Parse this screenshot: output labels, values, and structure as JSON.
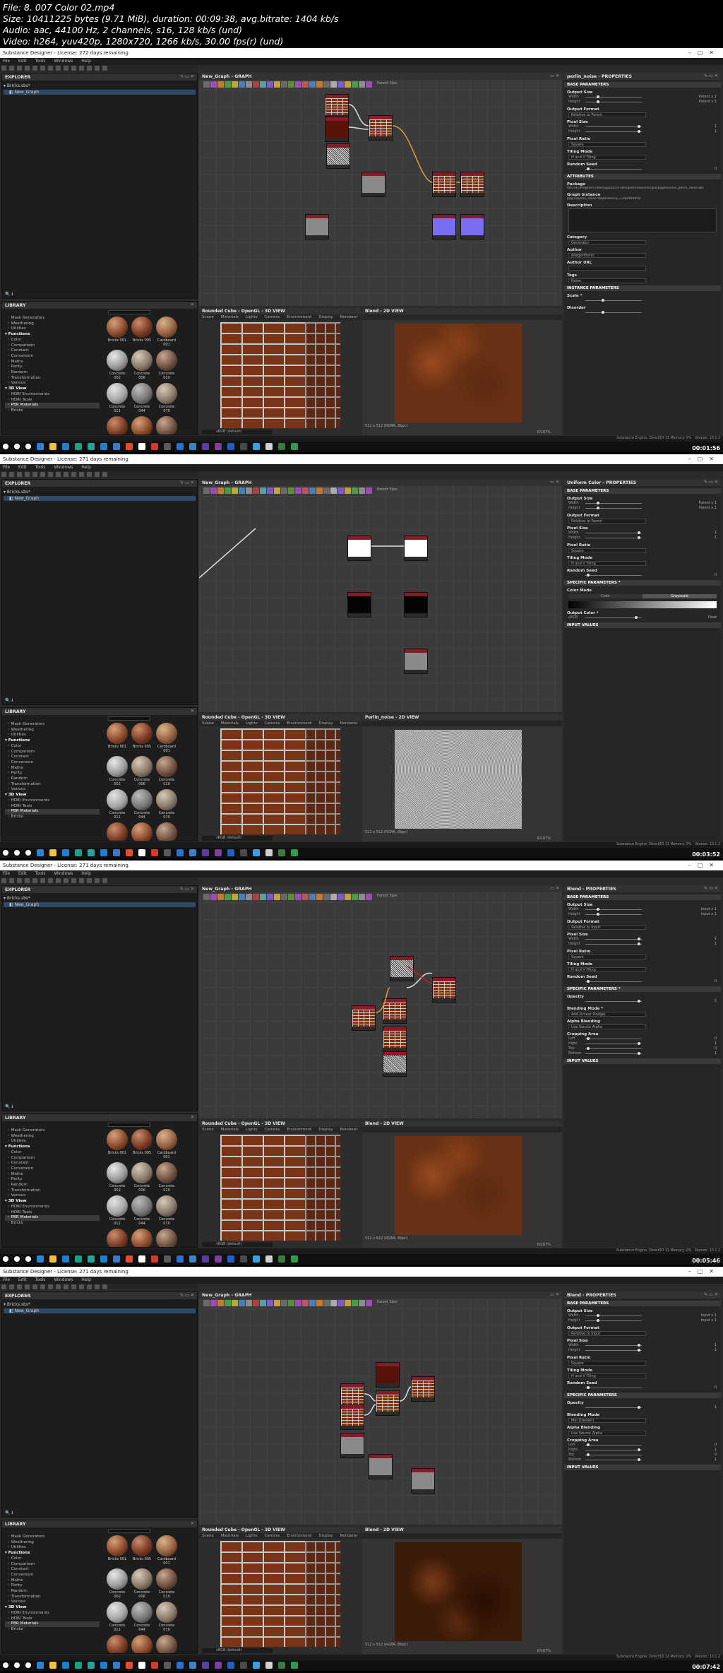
{
  "video_info": {
    "line1": "File: 8. 007 Color 02.mp4",
    "line2": "Size: 10411225 bytes (9.71 MiB), duration: 00:09:38, avg.bitrate: 1404 kb/s",
    "line3": "Audio: aac, 44100 Hz, 2 channels, s16, 128 kb/s (und)",
    "line4": "Video: h264, yuv420p, 1280x720, 1266 kb/s, 30.00 fps(r) (und)"
  },
  "app": {
    "title": "Substance Designer - License: 272 days remaining",
    "title_alt": "Substance Designer - License: 271 days remaining",
    "menu": [
      "File",
      "Edit",
      "Tools",
      "Windows",
      "Help"
    ],
    "explorer_title": "EXPLORER",
    "package_name": "Bricks.sbs*",
    "graph_name": "New_Graph",
    "graph_panel_title": "New_Graph - GRAPH",
    "parent_size": "Parent Size:",
    "library_title": "LIBRARY",
    "library_categories": [
      {
        "label": "Mask Generators",
        "type": "item"
      },
      {
        "label": "Weathering",
        "type": "item"
      },
      {
        "label": "Utilities",
        "type": "item"
      },
      {
        "label": "Functions",
        "type": "head"
      },
      {
        "label": "Color",
        "type": "item"
      },
      {
        "label": "Comparison",
        "type": "item"
      },
      {
        "label": "Constant",
        "type": "item"
      },
      {
        "label": "Conversion",
        "type": "item"
      },
      {
        "label": "Maths",
        "type": "item"
      },
      {
        "label": "Parity",
        "type": "item"
      },
      {
        "label": "Random",
        "type": "item"
      },
      {
        "label": "Transformation",
        "type": "item"
      },
      {
        "label": "Various",
        "type": "item"
      },
      {
        "label": "3D View",
        "type": "head"
      },
      {
        "label": "HDRI Environments",
        "type": "item"
      },
      {
        "label": "HDRI Tools",
        "type": "item"
      },
      {
        "label": "PBR Materials",
        "type": "sel"
      },
      {
        "label": "Bricks",
        "type": "item"
      }
    ],
    "materials": [
      {
        "label": "Bricks 001",
        "ball": "b0"
      },
      {
        "label": "Bricks 005",
        "ball": "b1"
      },
      {
        "label": "Cardboard 001",
        "ball": "b2"
      },
      {
        "label": "Concrete 002",
        "ball": "b3"
      },
      {
        "label": "Concrete 006",
        "ball": "b4"
      },
      {
        "label": "Concrete 010",
        "ball": "b5"
      },
      {
        "label": "Concrete 011",
        "ball": "b6"
      },
      {
        "label": "Concrete 044",
        "ball": "b7"
      },
      {
        "label": "Concrete 070",
        "ball": "b4"
      }
    ],
    "view3d_title": "Rounded Cube - OpenGL - 3D VIEW",
    "view3d_menu": [
      "Scene",
      "Materials",
      "Lights",
      "Camera",
      "Environment",
      "Display",
      "Renderer"
    ],
    "view3d_material": "sRGB (default)",
    "status_engine": "Substance Engine: Direct3D 11  Memory: 0%",
    "version": "Version: 10.1.2",
    "res_label": "512 x 512 (RGBA, 8bpc)",
    "zoom": "63.67%"
  },
  "frames": [
    {
      "title_key": "title",
      "view2d_title": "Blend - 2D VIEW",
      "props_title": "perlin_noise - PROPERTIES",
      "sections": [
        "BASE PARAMETERS",
        "ATTRIBUTES",
        "INSTANCE PARAMETERS"
      ],
      "timestamp": "00:01:56",
      "texture": "noise-brown",
      "fields": [
        {
          "label": "Output Size",
          "rows": [
            {
              "name": "Width",
              "val": "Parent x 1",
              "k": 0.2
            },
            {
              "name": "Height",
              "val": "Parent x 1",
              "k": 0.2
            }
          ]
        },
        {
          "label": "Output Format",
          "drop": "Relative to Parent"
        },
        {
          "label": "Pixel Size",
          "rows": [
            {
              "name": "Width",
              "val": "1",
              "k": 0.95
            },
            {
              "name": "Height",
              "val": "1",
              "k": 0.95
            }
          ]
        },
        {
          "label": "Pixel Ratio",
          "drop": "Square"
        },
        {
          "label": "Tiling Mode",
          "drop": "H and V Tiling"
        },
        {
          "label": "Random Seed",
          "rows": [
            {
              "name": "",
              "val": "0",
              "k": 0.02
            }
          ]
        }
      ],
      "package_path": "file:///E:/Program Files/Substance Designer/resources/packages/noise_perlin_noise.sbs",
      "graph_instance": "pkg:///perlin_noise?dependency=1282904959",
      "attr_labels": [
        "Package",
        "Graph Instance",
        "Description",
        "Category",
        "Author",
        "Author URL",
        "Tags"
      ],
      "attr_values": [
        "",
        "",
        "",
        "Generator",
        "Allegorithmic",
        "",
        "Noise"
      ],
      "extra": [
        "Scale *",
        "Disorder"
      ]
    },
    {
      "title_key": "title_alt",
      "view2d_title": "Perlin_noise - 2D VIEW",
      "props_title": "Uniform Color - PROPERTIES",
      "sections": [
        "BASE PARAMETERS",
        "SPECIFIC PARAMETERS *",
        "INPUT VALUES"
      ],
      "timestamp": "00:03:52",
      "texture": "noise-grey",
      "fields": [
        {
          "label": "Output Size",
          "rows": [
            {
              "name": "Width",
              "val": "Parent x 1",
              "k": 0.2
            },
            {
              "name": "Height",
              "val": "Parent x 1",
              "k": 0.2
            }
          ]
        },
        {
          "label": "Output Format",
          "drop": "Relative to Parent"
        },
        {
          "label": "Pixel Size",
          "rows": [
            {
              "name": "Width",
              "val": "1",
              "k": 0.95
            },
            {
              "name": "Height",
              "val": "1",
              "k": 0.95
            }
          ]
        },
        {
          "label": "Pixel Ratio",
          "drop": "Square"
        },
        {
          "label": "Tiling Mode",
          "drop": "H and V Tiling"
        },
        {
          "label": "Random Seed",
          "rows": [
            {
              "name": "",
              "val": "0",
              "k": 0.02
            }
          ]
        },
        {
          "label": "Color Mode",
          "toggle": [
            "Color",
            "Grayscale"
          ]
        },
        {
          "label": "Output Color *",
          "rows": [
            {
              "name": "sRGB",
              "val": "Float",
              "k": 0.9
            }
          ]
        }
      ]
    },
    {
      "title_key": "title_alt",
      "view2d_title": "Blend - 2D VIEW",
      "props_title": "Blend - PROPERTIES",
      "sections": [
        "BASE PARAMETERS",
        "SPECIFIC PARAMETERS *",
        "INPUT VALUES"
      ],
      "timestamp": "00:05:46",
      "texture": "noise-brown",
      "fields": [
        {
          "label": "Output Size",
          "rows": [
            {
              "name": "Width",
              "val": "Input x 1",
              "k": 0.2
            },
            {
              "name": "Height",
              "val": "Input x 1",
              "k": 0.2
            }
          ]
        },
        {
          "label": "Output Format",
          "drop": "Relative to Input"
        },
        {
          "label": "Pixel Size",
          "rows": [
            {
              "name": "Width",
              "val": "1",
              "k": 0.95
            },
            {
              "name": "Height",
              "val": "1",
              "k": 0.95
            }
          ]
        },
        {
          "label": "Pixel Ratio",
          "drop": "Square"
        },
        {
          "label": "Tiling Mode",
          "drop": "H and V Tiling"
        },
        {
          "label": "Random Seed",
          "rows": [
            {
              "name": "",
              "val": "0",
              "k": 0.02
            }
          ]
        },
        {
          "label": "Opacity",
          "rows": [
            {
              "name": "",
              "val": "1",
              "k": 0.95
            }
          ]
        },
        {
          "label": "Blending Mode *",
          "drop": "Add (Linear Dodge)"
        },
        {
          "label": "Alpha Blending",
          "drop": "Use Source Alpha"
        },
        {
          "label": "Cropping Area",
          "rows": [
            {
              "name": "Left",
              "val": "0",
              "k": 0.02
            },
            {
              "name": "Right",
              "val": "1",
              "k": 0.95
            },
            {
              "name": "Top",
              "val": "0",
              "k": 0.02
            },
            {
              "name": "Bottom",
              "val": "1",
              "k": 0.95
            }
          ]
        }
      ]
    },
    {
      "title_key": "title_alt",
      "view2d_title": "Blend - 2D VIEW",
      "props_title": "Blend - PROPERTIES",
      "sections": [
        "BASE PARAMETERS",
        "SPECIFIC PARAMETERS",
        "INPUT VALUES"
      ],
      "timestamp": "00:07:42",
      "texture": "noise-dark",
      "fields": [
        {
          "label": "Output Size",
          "rows": [
            {
              "name": "Width",
              "val": "Input x 1",
              "k": 0.2
            },
            {
              "name": "Height",
              "val": "Input x 1",
              "k": 0.2
            }
          ]
        },
        {
          "label": "Output Format",
          "drop": "Relative to Input"
        },
        {
          "label": "Pixel Size",
          "rows": [
            {
              "name": "Width",
              "val": "1",
              "k": 0.95
            },
            {
              "name": "Height",
              "val": "1",
              "k": 0.95
            }
          ]
        },
        {
          "label": "Pixel Ratio",
          "drop": "Square"
        },
        {
          "label": "Tiling Mode",
          "drop": "H and V Tiling"
        },
        {
          "label": "Random Seed",
          "rows": [
            {
              "name": "",
              "val": "0",
              "k": 0.02
            }
          ]
        },
        {
          "label": "Opacity",
          "rows": [
            {
              "name": "",
              "val": "1",
              "k": 0.95
            }
          ]
        },
        {
          "label": "Blending Mode",
          "drop": "Min (Darken)"
        },
        {
          "label": "Alpha Blending",
          "drop": "Use Source Alpha"
        },
        {
          "label": "Cropping Area",
          "rows": [
            {
              "name": "Left",
              "val": "0",
              "k": 0.02
            },
            {
              "name": "Right",
              "val": "1",
              "k": 0.95
            },
            {
              "name": "Top",
              "val": "0",
              "k": 0.02
            },
            {
              "name": "Bottom",
              "val": "1",
              "k": 0.95
            }
          ]
        }
      ]
    }
  ],
  "colors": {
    "accent": "#2f4a66",
    "brick": "#7a3518",
    "mortar": "#c8c8c8"
  },
  "taskbar_icons": [
    "windows-icon",
    "search-icon",
    "taskview-icon",
    "chrome-icon",
    "folder-icon",
    "app-icon",
    "app-icon",
    "app-icon",
    "app-icon",
    "app-icon",
    "app-icon",
    "app-icon",
    "app-icon",
    "app-icon",
    "app-icon",
    "app-icon",
    "app-icon",
    "app-icon",
    "app-icon",
    "app-icon",
    "app-icon",
    "app-icon",
    "app-icon",
    "app-icon"
  ]
}
